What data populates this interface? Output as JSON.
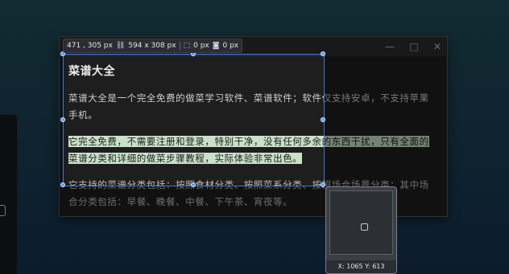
{
  "screenshot_tool": {
    "position_readout": "471 , 305 px",
    "size_readout": "594 x 308 px",
    "radius_readout": "0 px",
    "shadow_readout": "0 px",
    "cursor_coords": "X: 1065 Y: 613",
    "accent_color": "#3a7ad8",
    "highlight_color": "#c9e1c9"
  },
  "window": {
    "controls": {
      "minimize": "—",
      "maximize": "□",
      "close": "✕"
    }
  },
  "document": {
    "heading": "菜谱大全",
    "para1_line1": "菜谱大全是一个完全免费的做菜学习软件、菜谱软件；软件仅支持安卓，不支持苹果",
    "para1_line2": "手机。",
    "para2_line1": "它完全免费，不需要注册和登录，特别干净，没有任何多余的东西干扰，只有全面的",
    "para2_line2": "菜谱分类和详细的做菜步骤教程，实际体验非常出色。",
    "para3_line1": "它支持的菜谱分类包括：按照食材分类、按照菜系分类、按照场合场景分类；其中场",
    "para3_line2": "合分类包括：早餐、晚餐、中餐、下午茶、宵夜等。"
  }
}
